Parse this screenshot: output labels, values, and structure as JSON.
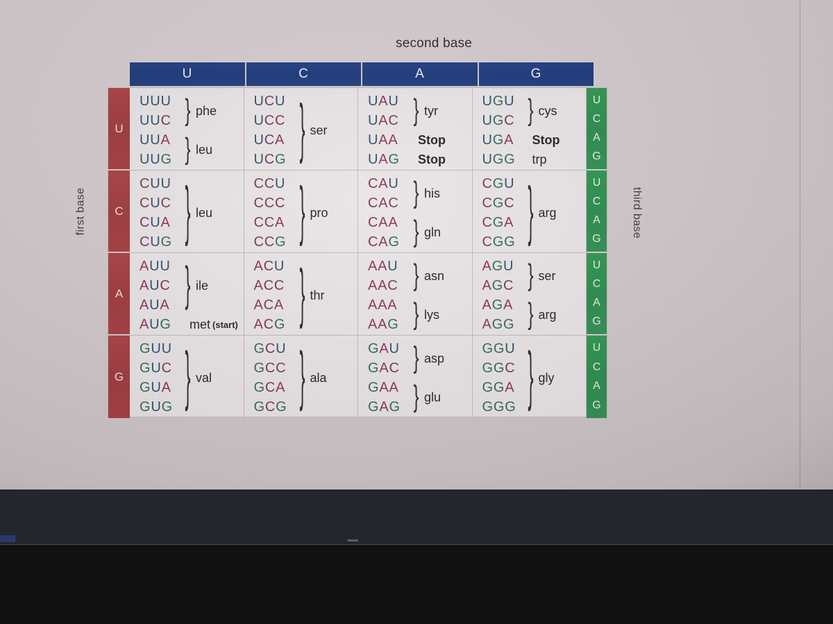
{
  "labels": {
    "second_base": "second base",
    "first_base": "first base",
    "third_base": "third base"
  },
  "colors": {
    "header_blue": "#1f3d84",
    "first_base_red": "#a63d41",
    "third_base_green": "#2f9652",
    "cell_background": "#e9e5e6",
    "page_background": "#cfc6c8"
  },
  "column_headers": [
    "U",
    "C",
    "A",
    "G"
  ],
  "third_base_letters": [
    "U",
    "C",
    "A",
    "G"
  ],
  "rows": [
    {
      "first_base": "U",
      "columns": [
        {
          "codons": [
            "UUU",
            "UUC",
            "UUA",
            "UUG"
          ],
          "groups": [
            {
              "label": "phe",
              "start": 0,
              "size": 2,
              "brace": true
            },
            {
              "label": "leu",
              "start": 2,
              "size": 2,
              "brace": true
            }
          ]
        },
        {
          "codons": [
            "UCU",
            "UCC",
            "UCA",
            "UCG"
          ],
          "groups": [
            {
              "label": "ser",
              "start": 0,
              "size": 4,
              "brace": true
            }
          ]
        },
        {
          "codons": [
            "UAU",
            "UAC",
            "UAA",
            "UAG"
          ],
          "groups": [
            {
              "label": "tyr",
              "start": 0,
              "size": 2,
              "brace": true
            },
            {
              "label": "Stop",
              "start": 2,
              "size": 1,
              "brace": false,
              "bold": true
            },
            {
              "label": "Stop",
              "start": 3,
              "size": 1,
              "brace": false,
              "bold": true
            }
          ]
        },
        {
          "codons": [
            "UGU",
            "UGC",
            "UGA",
            "UGG"
          ],
          "groups": [
            {
              "label": "cys",
              "start": 0,
              "size": 2,
              "brace": true
            },
            {
              "label": "Stop",
              "start": 2,
              "size": 1,
              "brace": false,
              "bold": true
            },
            {
              "label": "trp",
              "start": 3,
              "size": 1,
              "brace": false
            }
          ]
        }
      ]
    },
    {
      "first_base": "C",
      "columns": [
        {
          "codons": [
            "CUU",
            "CUC",
            "CUA",
            "CUG"
          ],
          "groups": [
            {
              "label": "leu",
              "start": 0,
              "size": 4,
              "brace": true
            }
          ]
        },
        {
          "codons": [
            "CCU",
            "CCC",
            "CCA",
            "CCG"
          ],
          "groups": [
            {
              "label": "pro",
              "start": 0,
              "size": 4,
              "brace": true
            }
          ]
        },
        {
          "codons": [
            "CAU",
            "CAC",
            "CAA",
            "CAG"
          ],
          "groups": [
            {
              "label": "his",
              "start": 0,
              "size": 2,
              "brace": true
            },
            {
              "label": "gln",
              "start": 2,
              "size": 2,
              "brace": true
            }
          ]
        },
        {
          "codons": [
            "CGU",
            "CGC",
            "CGA",
            "CGG"
          ],
          "groups": [
            {
              "label": "arg",
              "start": 0,
              "size": 4,
              "brace": true
            }
          ]
        }
      ]
    },
    {
      "first_base": "A",
      "columns": [
        {
          "codons": [
            "AUU",
            "AUC",
            "AUA",
            "AUG"
          ],
          "groups": [
            {
              "label": "ile",
              "start": 0,
              "size": 3,
              "brace": true
            },
            {
              "label": "met",
              "sublabel": "(start)",
              "start": 3,
              "size": 1,
              "brace": false
            }
          ]
        },
        {
          "codons": [
            "ACU",
            "ACC",
            "ACA",
            "ACG"
          ],
          "groups": [
            {
              "label": "thr",
              "start": 0,
              "size": 4,
              "brace": true
            }
          ]
        },
        {
          "codons": [
            "AAU",
            "AAC",
            "AAA",
            "AAG"
          ],
          "groups": [
            {
              "label": "asn",
              "start": 0,
              "size": 2,
              "brace": true
            },
            {
              "label": "lys",
              "start": 2,
              "size": 2,
              "brace": true
            }
          ]
        },
        {
          "codons": [
            "AGU",
            "AGC",
            "AGA",
            "AGG"
          ],
          "groups": [
            {
              "label": "ser",
              "start": 0,
              "size": 2,
              "brace": true
            },
            {
              "label": "arg",
              "start": 2,
              "size": 2,
              "brace": true
            }
          ]
        }
      ]
    },
    {
      "first_base": "G",
      "columns": [
        {
          "codons": [
            "GUU",
            "GUC",
            "GUA",
            "GUG"
          ],
          "groups": [
            {
              "label": "val",
              "start": 0,
              "size": 4,
              "brace": true
            }
          ]
        },
        {
          "codons": [
            "GCU",
            "GCC",
            "GCA",
            "GCG"
          ],
          "groups": [
            {
              "label": "ala",
              "start": 0,
              "size": 4,
              "brace": true
            }
          ]
        },
        {
          "codons": [
            "GAU",
            "GAC",
            "GAA",
            "GAG"
          ],
          "groups": [
            {
              "label": "asp",
              "start": 0,
              "size": 2,
              "brace": true
            },
            {
              "label": "glu",
              "start": 2,
              "size": 2,
              "brace": true
            }
          ]
        },
        {
          "codons": [
            "GGU",
            "GGC",
            "GGA",
            "GGG"
          ],
          "groups": [
            {
              "label": "gly",
              "start": 0,
              "size": 4,
              "brace": true
            }
          ]
        }
      ]
    }
  ]
}
